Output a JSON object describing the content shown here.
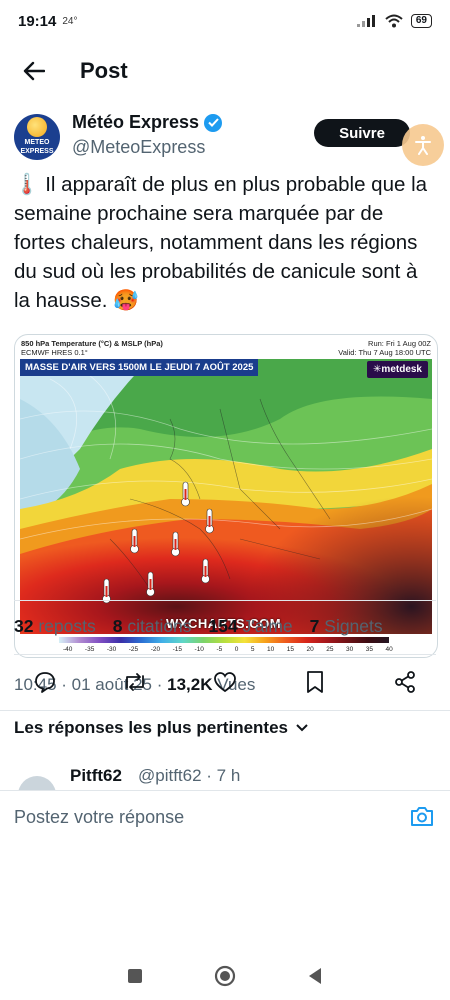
{
  "status": {
    "time": "19:14",
    "temp": "24°",
    "battery": "69"
  },
  "topbar": {
    "title": "Post"
  },
  "post": {
    "author_name": "Météo Express",
    "author_handle": "@MeteoExpress",
    "avatar_text_1": "METEO",
    "avatar_text_2": "EXPRESS",
    "follow_label": "Suivre",
    "text_emoji_start": "🌡️",
    "text_body": " Il apparaît de plus en plus probable que la semaine prochaine sera marquée par de fortes chaleurs, notamment dans les régions du sud où les probabilités de canicule sont à la hausse. ",
    "text_emoji_end": "🥵",
    "map": {
      "header_1": "850 hPa Temperature (°C) & MSLP (hPa)",
      "header_2": "ECMWF HRES 0.1°",
      "run": "Run: Fri 1 Aug 00Z",
      "valid": "Valid: Thu 7 Aug 18:00 UTC",
      "banner": "MASSE D'AIR VERS 1500M LE JEUDI 7 AOÛT 2025",
      "brand": "metdesk",
      "watermark": "WXCHARTS.COM",
      "scale": [
        "-40",
        "-35",
        "-30",
        "-25",
        "-20",
        "-15",
        "-10",
        "-5",
        "0",
        "5",
        "10",
        "15",
        "20",
        "25",
        "30",
        "35",
        "40"
      ]
    },
    "time": "10:45",
    "date": "01 août 25",
    "views_count": "13,2K",
    "views_label": "Vues",
    "stats": {
      "reposts_count": "32",
      "reposts_label": "reposts",
      "citations_count": "8",
      "citations_label": "citations",
      "likes_count": "154",
      "likes_label": "J'aime",
      "bookmarks_count": "7",
      "bookmarks_label": "Signets"
    }
  },
  "replies": {
    "header": "Les réponses les plus pertinentes",
    "first_name": "Pitft62",
    "first_handle": "@pitft62 · 7 h"
  },
  "compose": {
    "placeholder": "Postez votre réponse"
  },
  "colors": {
    "accent": "#1d9bf0",
    "text": "#0f1419",
    "muted": "#536471"
  },
  "icons": [
    "back-arrow-icon",
    "verified-icon",
    "reply-icon",
    "repost-icon",
    "like-icon",
    "bookmark-icon",
    "share-icon",
    "camera-icon",
    "chevron-down-icon"
  ]
}
